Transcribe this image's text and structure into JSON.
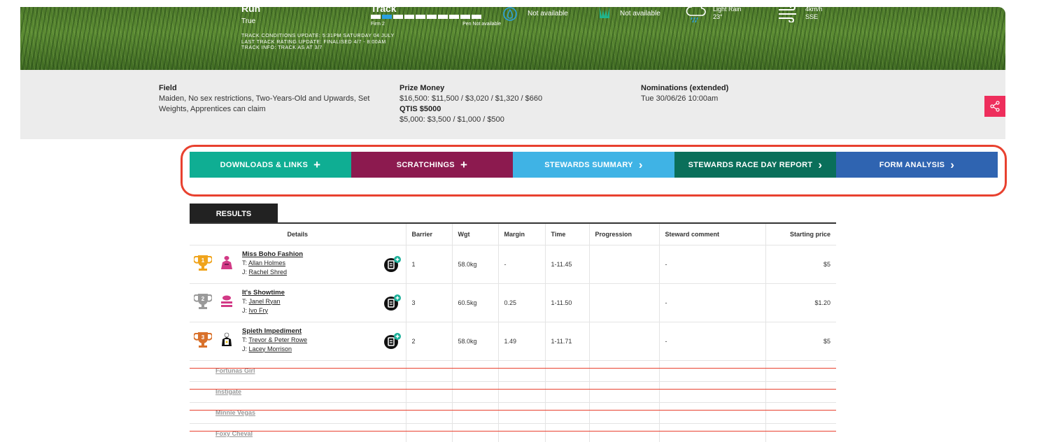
{
  "hero": {
    "run_title": "Run",
    "run_value": "True",
    "track_updates": [
      "TRACK CONDITIONS UPDATE: 5:31PM SATURDAY 04 JULY",
      "LAST TRACK RATING UPDATE: FINALISED 4/7 - 8:00AM",
      "TRACK INFO: TRACK AS AT 3/7"
    ],
    "track_title": "Track",
    "track_left_label": "Firm 2",
    "track_right_label": "Pen Not available",
    "track_rating_active_index": 1,
    "penetrometer_text": "Not available",
    "grass_text": "Not available",
    "weather_desc": "Light Rain",
    "weather_temp": "23°",
    "wind_speed": "4km/h",
    "wind_dir": "SSE"
  },
  "info": {
    "field_heading": "Field",
    "field_text": "Maiden, No sex restrictions, Two-Years-Old and Upwards, Set Weights, Apprentices can claim",
    "prize_heading": "Prize Money",
    "prize_text": "$16,500: $11,500 / $3,020 / $1,320 / $660",
    "qtis_heading": "QTIS $5000",
    "qtis_text": "$5,000: $3,500 / $1,000 / $500",
    "nominations_heading": "Nominations (extended)",
    "nominations_text": "Tue 30/06/26 10:00am"
  },
  "actions": [
    {
      "label": "DOWNLOADS & LINKS",
      "symbol": "+",
      "color": "#0fae93"
    },
    {
      "label": "SCRATCHINGS",
      "symbol": "+",
      "color": "#8c1a4f"
    },
    {
      "label": "STEWARDS SUMMARY",
      "symbol": "›",
      "color": "#3fb3e5"
    },
    {
      "label": "STEWARDS RACE DAY REPORT",
      "symbol": "›",
      "color": "#0a6f5a"
    },
    {
      "label": "FORM ANALYSIS",
      "symbol": "›",
      "color": "#2f64b1"
    }
  ],
  "results": {
    "tab_label": "RESULTS",
    "columns": [
      "Details",
      "Barrier",
      "Wgt",
      "Margin",
      "Time",
      "Progression",
      "Steward comment",
      "Starting price"
    ],
    "runners": [
      {
        "place": "1",
        "name": "Miss Boho Fashion",
        "trainer_prefix": "T:",
        "trainer": "Allan Holmes",
        "jockey_prefix": "J:",
        "jockey": "Rachel Shred",
        "barrier": "1",
        "weight": "58.0kg",
        "margin": "-",
        "time": "1-11.45",
        "progression": "",
        "comment": "-",
        "price": "$5",
        "trophy_color": "#f0a41c"
      },
      {
        "place": "2",
        "name": "It's Showtime",
        "trainer_prefix": "T:",
        "trainer": "Janel Ryan",
        "jockey_prefix": "J:",
        "jockey": "Ivo Fry",
        "barrier": "3",
        "weight": "60.5kg",
        "margin": "0.25",
        "time": "1-11.50",
        "progression": "",
        "comment": "-",
        "price": "$1.20",
        "trophy_color": "#9a9a9a"
      },
      {
        "place": "3",
        "name": "Spieth Impediment",
        "trainer_prefix": "T:",
        "trainer": "Trevor & Peter Rowe",
        "jockey_prefix": "J:",
        "jockey": "Lacey Morrison",
        "barrier": "2",
        "weight": "58.0kg",
        "margin": "1.49",
        "time": "1-11.71",
        "progression": "",
        "comment": "-",
        "price": "$5",
        "trophy_color": "#d9712b"
      }
    ],
    "scratched": [
      "Fortunas Girl",
      "Instigate",
      "Minnie Vegas",
      "Foxy Cheval"
    ]
  }
}
